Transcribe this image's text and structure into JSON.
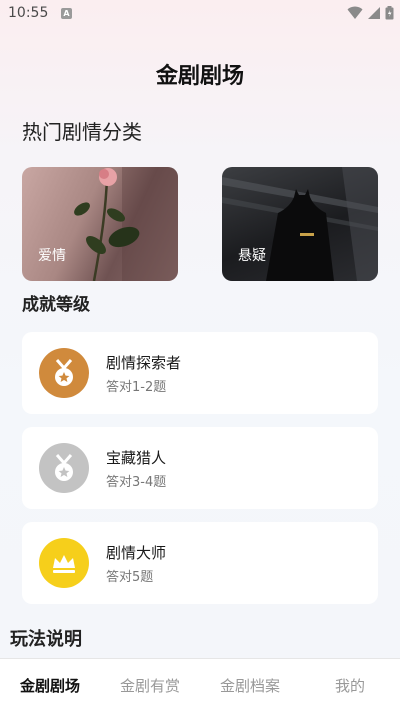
{
  "status_bar": {
    "time": "10:55",
    "notif_letter": "A"
  },
  "page_title": "金剧剧场",
  "categories": {
    "title": "热门剧情分类",
    "items": [
      {
        "label": "爱情"
      },
      {
        "label": "悬疑"
      }
    ]
  },
  "achievements": {
    "title": "成就等级",
    "items": [
      {
        "name": "剧情探索者",
        "desc": "答对1-2题",
        "color": "#d08a3c"
      },
      {
        "name": "宝藏猎人",
        "desc": "答对3-4题",
        "color": "#c3c3c3"
      },
      {
        "name": "剧情大师",
        "desc": "答对5题",
        "color": "#f6cf1b"
      }
    ]
  },
  "play_section": {
    "title": "玩法说明"
  },
  "tabs": [
    {
      "label": "金剧剧场",
      "active": true
    },
    {
      "label": "金剧有赏",
      "active": false
    },
    {
      "label": "金剧档案",
      "active": false
    },
    {
      "label": "我的",
      "active": false
    }
  ]
}
